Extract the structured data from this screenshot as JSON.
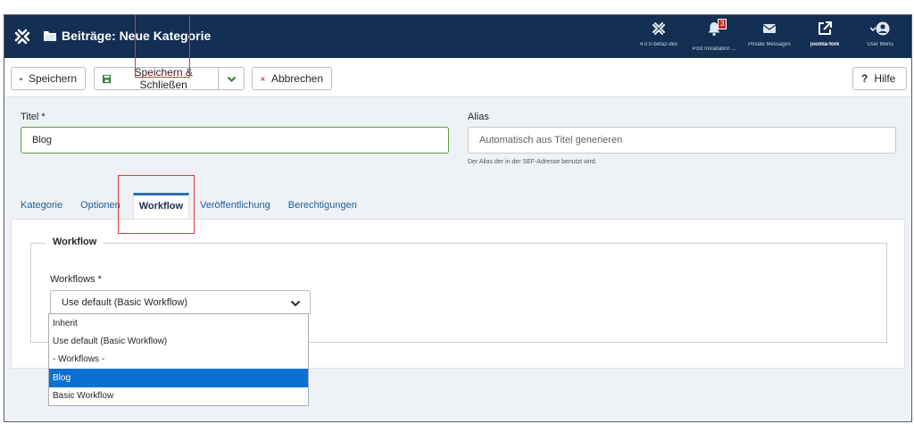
{
  "header": {
    "title": "Beiträge: Neue Kategorie",
    "items": [
      {
        "icon": "joomla-icon",
        "label": "4.0.0-beta2-dev"
      },
      {
        "icon": "bell-icon",
        "label": "Post Installation ...",
        "badge": "3"
      },
      {
        "icon": "envelope-icon",
        "label": "Private Messages"
      },
      {
        "icon": "external-link-icon",
        "label": "joomla-fork"
      },
      {
        "icon": "user-icon",
        "label": "User Menu"
      }
    ]
  },
  "toolbar": {
    "save_label": "Speichern",
    "save_close_label": "Speichern & Schließen",
    "cancel_label": "Abbrechen",
    "help_label": "Hilfe"
  },
  "form": {
    "title_label": "Titel *",
    "title_value": "Blog",
    "alias_label": "Alias",
    "alias_placeholder": "Automatisch aus Titel generieren",
    "alias_hint": "Der Alias der in der SEF-Adresse benutzt wird."
  },
  "tabs": [
    "Kategorie",
    "Optionen",
    "Workflow",
    "Veröffentlichung",
    "Berechtigungen"
  ],
  "active_tab": "Workflow",
  "workflow": {
    "legend": "Workflow",
    "field_label": "Workflows *",
    "selected": "Use default (Basic Workflow)",
    "options": [
      "Inherit",
      "Use default (Basic Workflow)",
      "- Workflows -",
      "Blog",
      "Basic Workflow"
    ],
    "highlighted_option": "Blog"
  },
  "colors": {
    "header_bg": "#132f53",
    "accent": "#2b6fb1",
    "save_icon": "#2d7a3a",
    "cancel_icon": "#c52827",
    "highlight": "#0a71d1",
    "marker": "#e03a3a"
  }
}
